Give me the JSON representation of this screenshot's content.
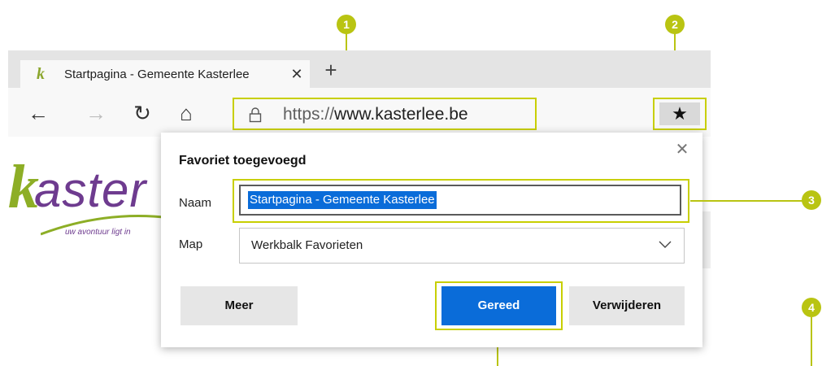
{
  "browser": {
    "tab": {
      "title": "Startpagina - Gemeente Kasterlee",
      "close_glyph": "✕",
      "favicon_letter": "k"
    },
    "new_tab_glyph": "+",
    "nav": {
      "back_glyph": "←",
      "forward_glyph": "→",
      "refresh_glyph": "↻",
      "home_glyph": "⌂"
    },
    "address": {
      "scheme": "https://",
      "host": "www.kasterlee.be"
    },
    "favorite_glyph": "★"
  },
  "site": {
    "logo_k": "k",
    "logo_text": "aster",
    "tagline": "uw avontuur ligt in"
  },
  "dialog": {
    "title": "Favoriet toegevoegd",
    "close_glyph": "✕",
    "name_label": "Naam",
    "name_value": "Startpagina - Gemeente Kasterlee",
    "folder_label": "Map",
    "folder_value": "Werkbalk Favorieten",
    "more_button": "Meer",
    "done_button": "Gereed",
    "remove_button": "Verwijderen"
  },
  "callouts": [
    "1",
    "2",
    "3",
    "4"
  ],
  "colors": {
    "accent_blue": "#0a6cd9",
    "callout": "#b9c412",
    "highlight_border": "#c8cf00"
  }
}
